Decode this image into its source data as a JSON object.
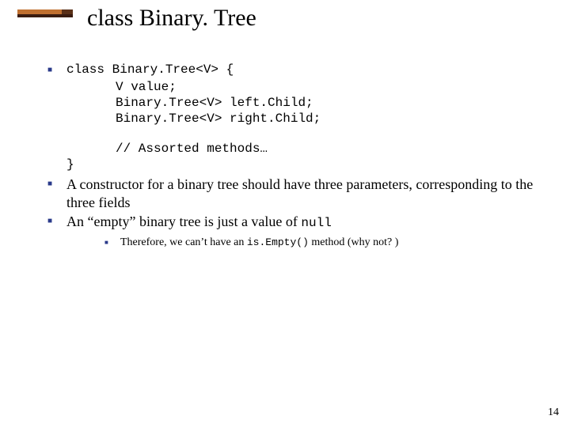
{
  "title": "class Binary. Tree",
  "code": {
    "l1": "class Binary.Tree<V> {",
    "l2": "V value;",
    "l3": "Binary.Tree<V> left.Child;",
    "l4": "Binary.Tree<V> right.Child;",
    "l5": "// Assorted methods…",
    "l6": "}"
  },
  "bullets": {
    "b2": "A constructor for a binary tree should have three parameters, corresponding to the three fields",
    "b3_pre": "An “empty” binary tree is just a value of ",
    "b3_code": "null"
  },
  "sub": {
    "pre": "Therefore, we can’t have an ",
    "code": "is.Empty()",
    "post": " method (why not? )"
  },
  "page": "14"
}
